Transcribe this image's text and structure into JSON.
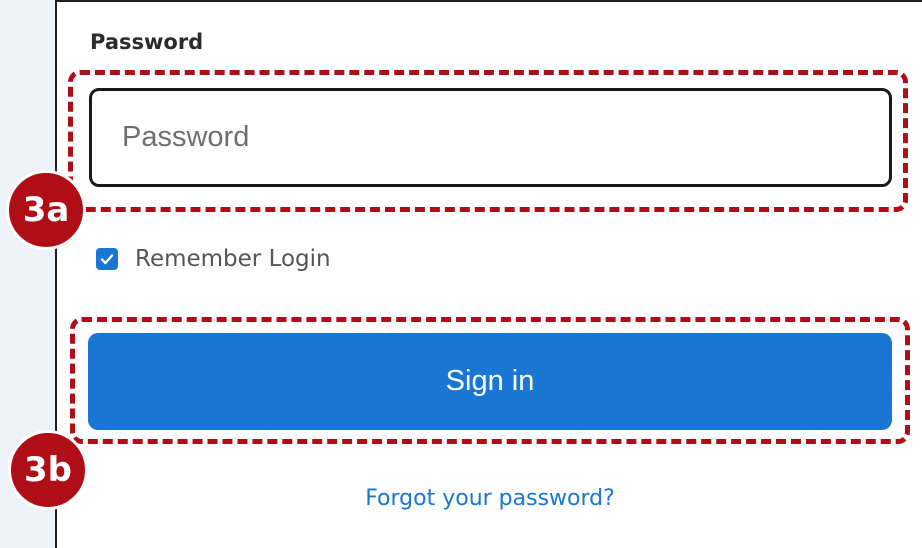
{
  "form": {
    "password_label": "Password",
    "password_placeholder": "Password",
    "password_value": "",
    "remember_label": "Remember Login",
    "remember_checked": true,
    "signin_label": "Sign in",
    "forgot_label": "Forgot your password?"
  },
  "annotations": {
    "step_a": "3a",
    "step_b": "3b"
  },
  "colors": {
    "accent": "#1976d2",
    "annotation": "#b00e16"
  }
}
